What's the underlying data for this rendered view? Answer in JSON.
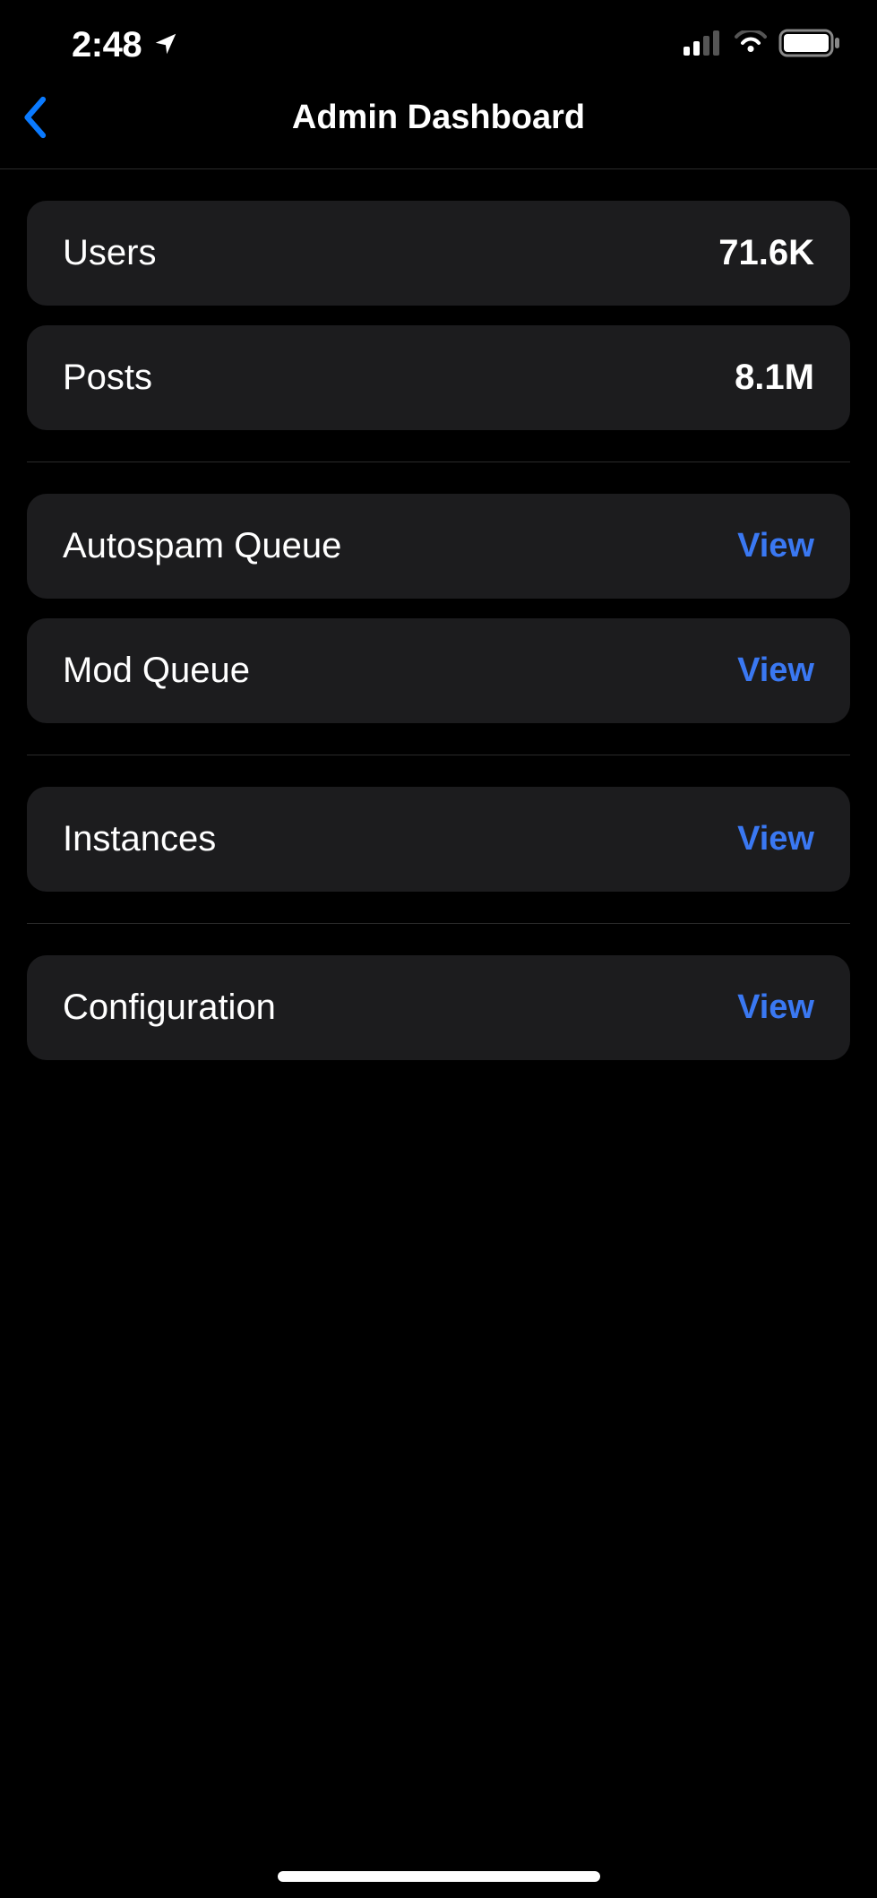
{
  "statusBar": {
    "time": "2:48"
  },
  "nav": {
    "title": "Admin Dashboard"
  },
  "stats": [
    {
      "label": "Users",
      "value": "71.6K"
    },
    {
      "label": "Posts",
      "value": "8.1M"
    }
  ],
  "queues": [
    {
      "label": "Autospam Queue",
      "action": "View"
    },
    {
      "label": "Mod Queue",
      "action": "View"
    }
  ],
  "instances": [
    {
      "label": "Instances",
      "action": "View"
    }
  ],
  "config": [
    {
      "label": "Configuration",
      "action": "View"
    }
  ]
}
